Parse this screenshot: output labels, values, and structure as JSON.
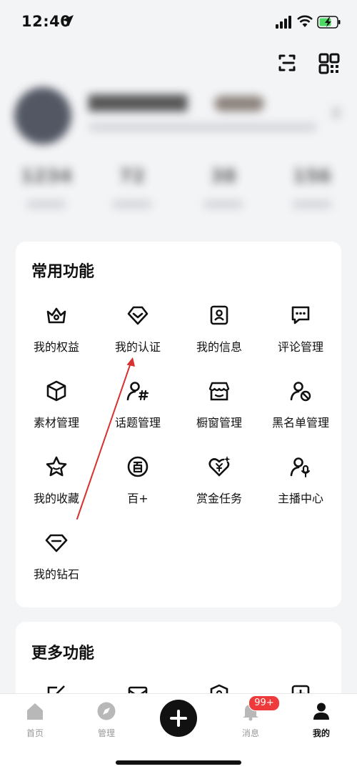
{
  "status_bar": {
    "time": "12:40"
  },
  "profile": {
    "stats": [
      "1234",
      "72",
      "38",
      "156"
    ]
  },
  "common_functions": {
    "title": "常用功能",
    "items": [
      {
        "label": "我的权益",
        "icon": "crown-icon"
      },
      {
        "label": "我的认证",
        "icon": "verified-chevron-icon"
      },
      {
        "label": "我的信息",
        "icon": "id-card-icon"
      },
      {
        "label": "评论管理",
        "icon": "comment-icon"
      },
      {
        "label": "素材管理",
        "icon": "cube-icon"
      },
      {
        "label": "话题管理",
        "icon": "user-hashtag-icon"
      },
      {
        "label": "橱窗管理",
        "icon": "storefront-icon"
      },
      {
        "label": "黑名单管理",
        "icon": "user-block-icon"
      },
      {
        "label": "我的收藏",
        "icon": "star-icon"
      },
      {
        "label": "百+",
        "icon": "bai-badge-icon"
      },
      {
        "label": "赏金任务",
        "icon": "reward-heart-icon"
      },
      {
        "label": "主播中心",
        "icon": "user-mic-icon"
      },
      {
        "label": "我的钻石",
        "icon": "diamond-icon"
      }
    ]
  },
  "more_functions": {
    "title": "更多功能"
  },
  "tabbar": {
    "items": [
      {
        "label": "首页",
        "icon": "home-icon"
      },
      {
        "label": "管理",
        "icon": "compass-icon"
      },
      {
        "label": "消息",
        "icon": "bell-icon",
        "badge": "99+"
      },
      {
        "label": "我的",
        "icon": "person-icon"
      }
    ],
    "active": "我的"
  },
  "annotation": {
    "color": "#d93030"
  }
}
